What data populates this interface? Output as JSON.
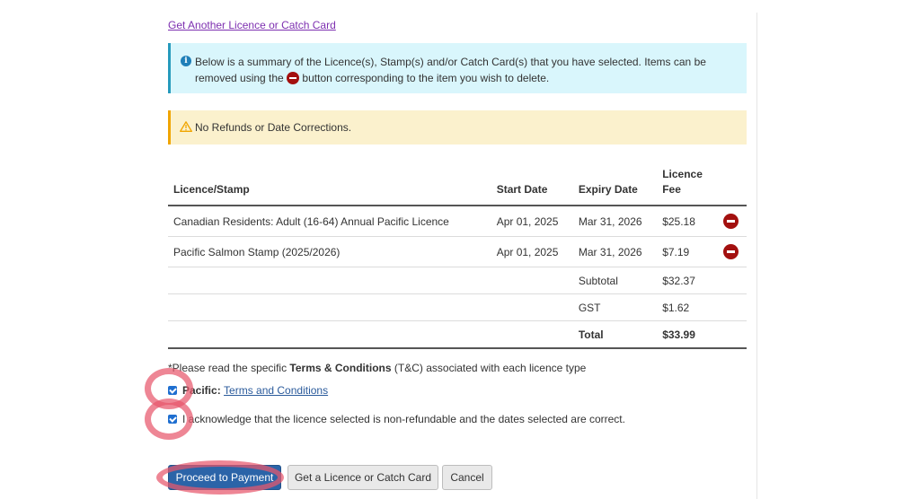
{
  "top_link": "Get Another Licence or Catch Card",
  "info_alert": {
    "text_before": "Below is a summary of the Licence(s), Stamp(s) and/or Catch Card(s) that you have selected. Items can be removed using the",
    "text_after": "button corresponding to the item you wish to delete."
  },
  "warning_alert": {
    "text": "No Refunds or Date Corrections."
  },
  "table": {
    "headers": [
      "Licence/Stamp",
      "Start Date",
      "Expiry Date",
      "Licence Fee"
    ],
    "rows": [
      {
        "name": "Canadian Residents: Adult (16-64) Annual Pacific Licence",
        "start": "Apr 01, 2025",
        "expiry": "Mar 31, 2026",
        "fee": "$25.18"
      },
      {
        "name": "Pacific Salmon Stamp (2025/2026)",
        "start": "Apr 01, 2025",
        "expiry": "Mar 31, 2026",
        "fee": "$7.19"
      }
    ],
    "summary": [
      {
        "label": "Subtotal",
        "value": "$32.37"
      },
      {
        "label": "GST",
        "value": "$1.62"
      },
      {
        "label": "Total",
        "value": "$33.99"
      }
    ]
  },
  "terms": {
    "note_prefix": "*Please read the specific",
    "note_bold": "Terms & Conditions",
    "note_suffix": "(T&C) associated with each licence type",
    "pacific_label": "Pacific:",
    "pacific_link": "Terms and Conditions",
    "pacific_checked": true,
    "acknowledge_text": "I acknowledge that the licence selected is non-refundable and the dates selected are correct.",
    "acknowledge_checked": true
  },
  "buttons": {
    "proceed": "Proceed to Payment",
    "get_licence": "Get a Licence or Catch Card",
    "cancel": "Cancel"
  },
  "colors": {
    "primary_button": "#2b64a8",
    "delete_icon": "#a3100f",
    "info_bg": "#d9f6fc",
    "warning_bg": "#fbf1cd",
    "annotation_ring": "#e8586c"
  }
}
